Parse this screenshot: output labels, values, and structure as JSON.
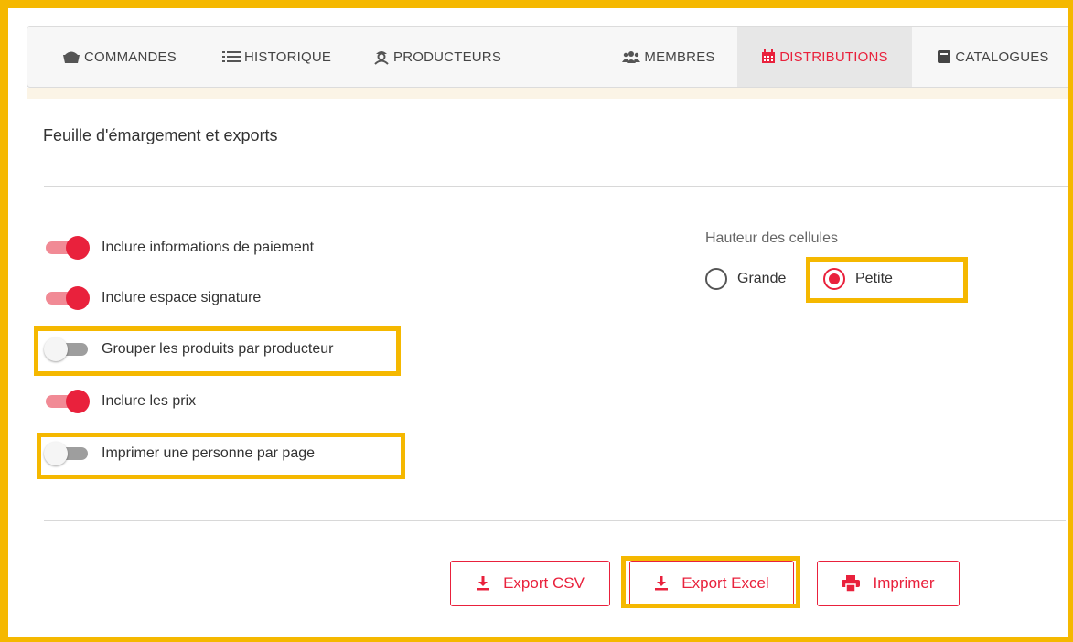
{
  "nav": {
    "commandes": "COMMANDES",
    "historique": "HISTORIQUE",
    "producteurs": "PRODUCTEURS",
    "membres": "MEMBRES",
    "distributions": "DISTRIBUTIONS",
    "catalogues": "CATALOGUES",
    "active": "DISTRIBUTIONS"
  },
  "panel": {
    "title": "Feuille d'émargement et exports"
  },
  "options": [
    {
      "label": "Inclure informations de paiement",
      "on": true
    },
    {
      "label": "Inclure espace signature",
      "on": true
    },
    {
      "label": "Grouper les produits par producteur",
      "on": false
    },
    {
      "label": "Inclure les prix",
      "on": true
    },
    {
      "label": "Imprimer une personne par page",
      "on": false
    }
  ],
  "cell_height": {
    "title": "Hauteur des cellules",
    "options": [
      "Grande",
      "Petite"
    ],
    "selected": "Petite"
  },
  "buttons": {
    "export_csv": "Export CSV",
    "export_excel": "Export Excel",
    "print": "Imprimer"
  },
  "colors": {
    "accent": "#e9213c",
    "highlight": "#f5b800",
    "toggle_on_track": "#f18a95",
    "toggle_off_track": "#9e9e9e"
  },
  "icons": {
    "commandes": "basket-icon",
    "historique": "list-icon",
    "producteurs": "farmer-icon",
    "membres": "users-icon",
    "distributions": "calendar-icon",
    "catalogues": "book-icon",
    "export": "download-icon",
    "print": "printer-icon"
  }
}
